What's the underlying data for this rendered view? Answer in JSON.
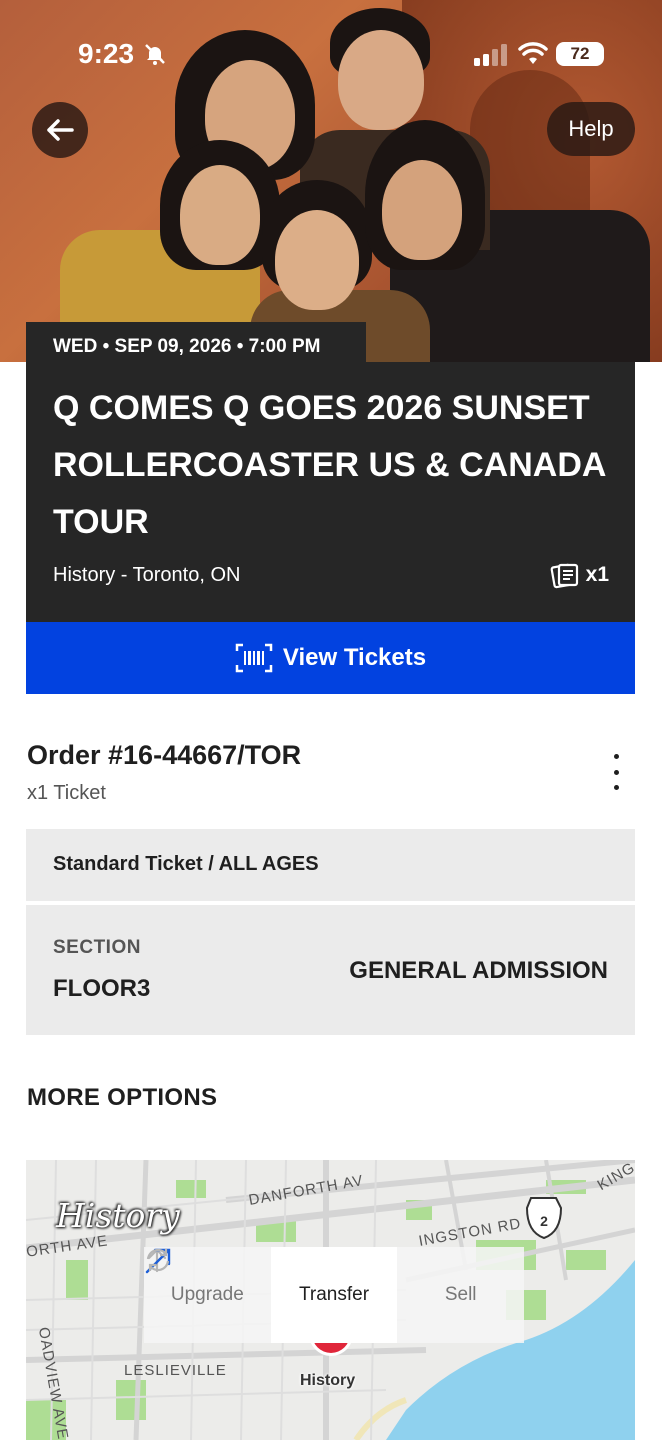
{
  "status_bar": {
    "time": "9:23",
    "battery": "72"
  },
  "header": {
    "help_label": "Help"
  },
  "event": {
    "date_line": "WED • SEP 09, 2026 • 7:00 PM",
    "title": "Q COMES Q GOES 2026 SUNSET ROLLERCOASTER US & CANADA TOUR",
    "venue_line": "History - Toronto, ON",
    "ticket_count": "x1",
    "view_tickets_label": "View Tickets"
  },
  "order": {
    "title": "Order #16-44667/TOR",
    "subtitle": "x1 Ticket",
    "ticket_type": "Standard Ticket / ALL AGES",
    "section_label": "SECTION",
    "section_value": "FLOOR3",
    "admission": "GENERAL ADMISSION"
  },
  "more_options_label": "MORE OPTIONS",
  "map": {
    "venue_name": "History",
    "pin_label": "History",
    "street_labels": [
      "DANFORTH AV",
      "ORTH AVE",
      "INGSTON RD",
      "KING",
      "LESLIEVILLE",
      "OADVIEW AVE"
    ],
    "route_badge": "2",
    "actions": [
      {
        "label": "Upgrade",
        "icon": "arrow-up-icon"
      },
      {
        "label": "Transfer",
        "icon": "arrow-diagonal-icon"
      },
      {
        "label": "Sell",
        "icon": "refresh-icon"
      }
    ]
  },
  "colors": {
    "primary_button": "#0242e0",
    "card_bg": "#262626",
    "pin": "#e0263a"
  }
}
